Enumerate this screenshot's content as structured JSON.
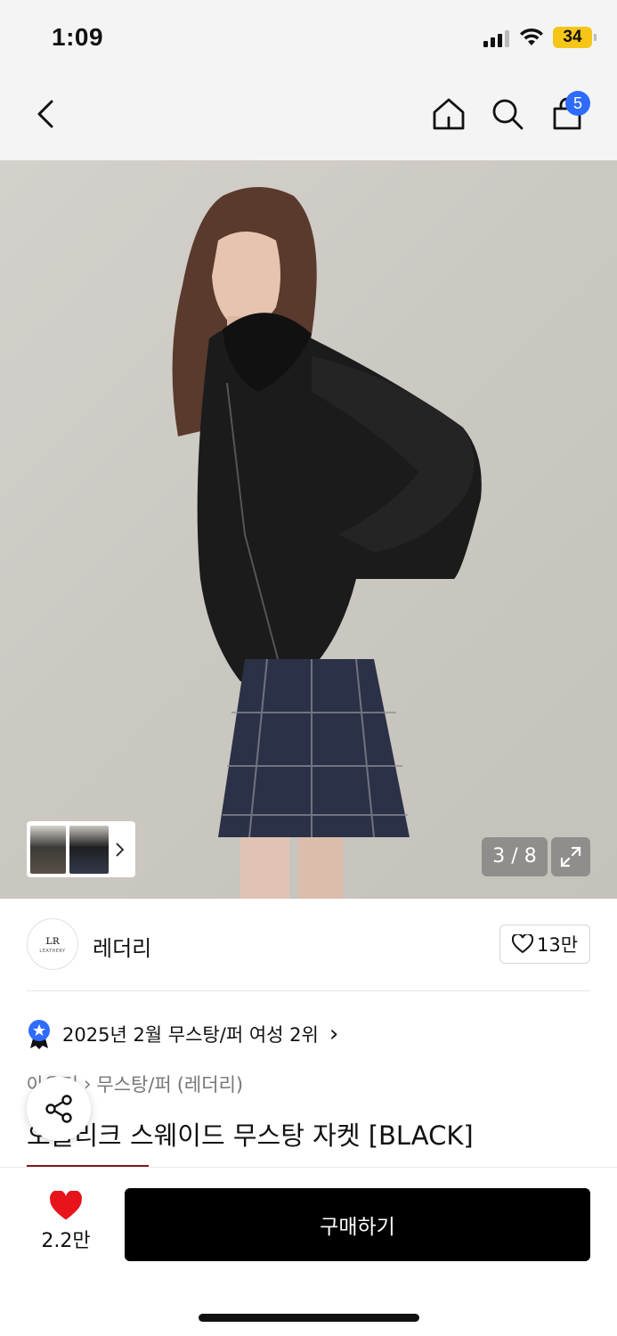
{
  "status_bar": {
    "time": "1:09",
    "battery": "34"
  },
  "nav": {
    "back_icon": "chevron-left-icon",
    "home_icon": "home-icon",
    "search_icon": "search-icon",
    "cart_icon": "shopping-bag-icon",
    "cart_count": "5"
  },
  "gallery": {
    "counter": "3 / 8",
    "expand_icon": "expand-icon"
  },
  "brand": {
    "name": "레더리",
    "logo_text": "LEATHERY",
    "like_count": "13만"
  },
  "ranking": {
    "text": "2025년 2월 무스탕/퍼 여성 2위",
    "chevron": "›"
  },
  "breadcrumb": {
    "items": [
      "아우터",
      "무스탕/퍼",
      "(레더리)"
    ]
  },
  "product": {
    "title": "오블리크 스웨이드 무스탕 자켓 [BLACK]"
  },
  "bottom": {
    "wish_count": "2.2만",
    "buy_label": "구매하기"
  },
  "colors": {
    "accent_blue": "#2f6bff",
    "heart_red": "#e8141c",
    "buy_bg": "#000000"
  }
}
